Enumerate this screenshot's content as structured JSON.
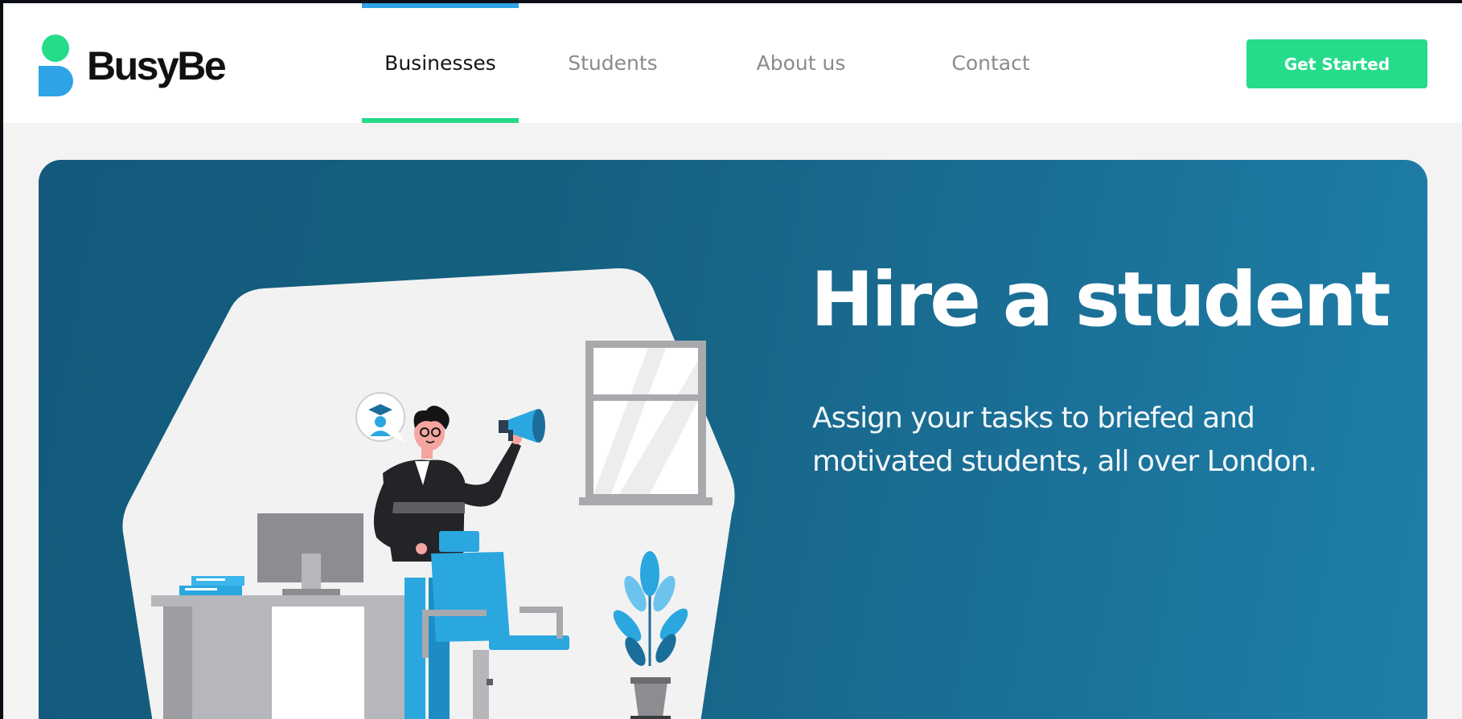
{
  "brand": {
    "name": "BusyBe",
    "colors": {
      "green": "#25dc8a",
      "blue": "#2ea3e6",
      "hero_dark": "#135a7c",
      "hero_light": "#1e7fa9"
    }
  },
  "nav": {
    "items": [
      {
        "label": "Businesses",
        "active": true
      },
      {
        "label": "Students",
        "active": false
      },
      {
        "label": "About us",
        "active": false
      },
      {
        "label": "Contact",
        "active": false
      }
    ]
  },
  "header": {
    "cta_label": "Get Started"
  },
  "hero": {
    "title": "Hire a student",
    "subtitle": "Assign your tasks to briefed and motivated students, all over London.",
    "illustration": {
      "icons": [
        "student-graduate-icon",
        "megaphone-icon",
        "monitor-icon",
        "office-chair-icon",
        "potted-plant-icon",
        "window-icon",
        "books-icon",
        "desk-icon"
      ]
    }
  }
}
